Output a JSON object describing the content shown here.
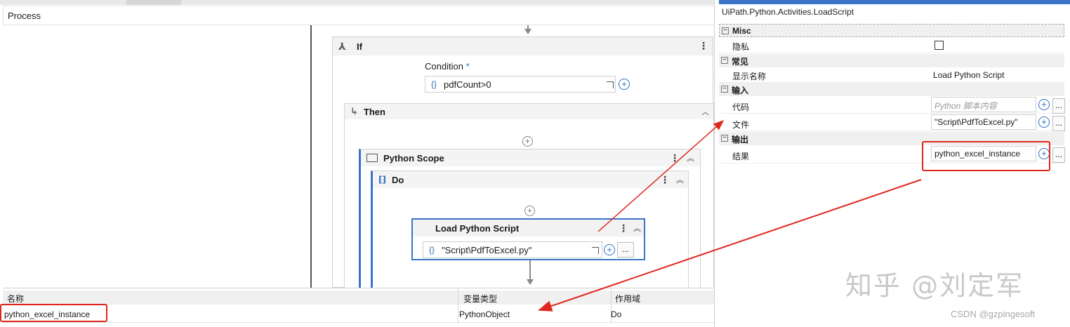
{
  "designer": {
    "breadcrumb": "Process",
    "if_activity": {
      "title": "If",
      "condition_label": "Condition",
      "required_mark": "*",
      "condition_value": "pdfCount>0"
    },
    "then_branch": {
      "title": "Then"
    },
    "python_scope": {
      "title": "Python Scope"
    },
    "do_sequence": {
      "title": "Do"
    },
    "load_script": {
      "title": "Load Python Script",
      "file_value": "\"Script\\PdfToExcel.py\"",
      "ellipsis": "..."
    },
    "brace_icon": "{}"
  },
  "variables": {
    "headers": {
      "name": "名称",
      "type": "变量类型",
      "scope": "作用域"
    },
    "rows": [
      {
        "name": "python_excel_instance",
        "type": "PythonObject",
        "scope": "Do"
      }
    ]
  },
  "properties": {
    "title": "UiPath.Python.Activities.LoadScript",
    "categories": [
      {
        "label": "Misc",
        "toggle": "⊟",
        "props": [
          {
            "name": "隐私",
            "kind": "checkbox",
            "checked": false
          }
        ]
      },
      {
        "label": "常见",
        "toggle": "⊟",
        "props": [
          {
            "name": "显示名称",
            "value": "Load Python Script"
          }
        ]
      },
      {
        "label": "输入",
        "toggle": "⊟",
        "props": [
          {
            "name": "代码",
            "placeholder": "Python 脚本内容"
          },
          {
            "name": "文件",
            "value": "\"Script\\PdfToExcel.py\""
          }
        ]
      },
      {
        "label": "输出",
        "toggle": "⊟",
        "props": [
          {
            "name": "结果",
            "value": "python_excel_instance"
          }
        ]
      }
    ],
    "ellipsis": "..."
  },
  "watermark": {
    "zhihu": "知乎 @刘定军",
    "csdn": "CSDN @gzpingesoft"
  },
  "colors": {
    "accent_blue": "#2b6fc2",
    "annotation_red": "#e0271e",
    "selection_border": "#3b73c8"
  },
  "icons": [
    "if-branch-icon",
    "then-arrow-icon",
    "python-scope-icon",
    "sequence-icon",
    "add-activity-icon",
    "more-options-icon",
    "collapse-icon",
    "expand-editor-icon",
    "add-argument-icon"
  ]
}
